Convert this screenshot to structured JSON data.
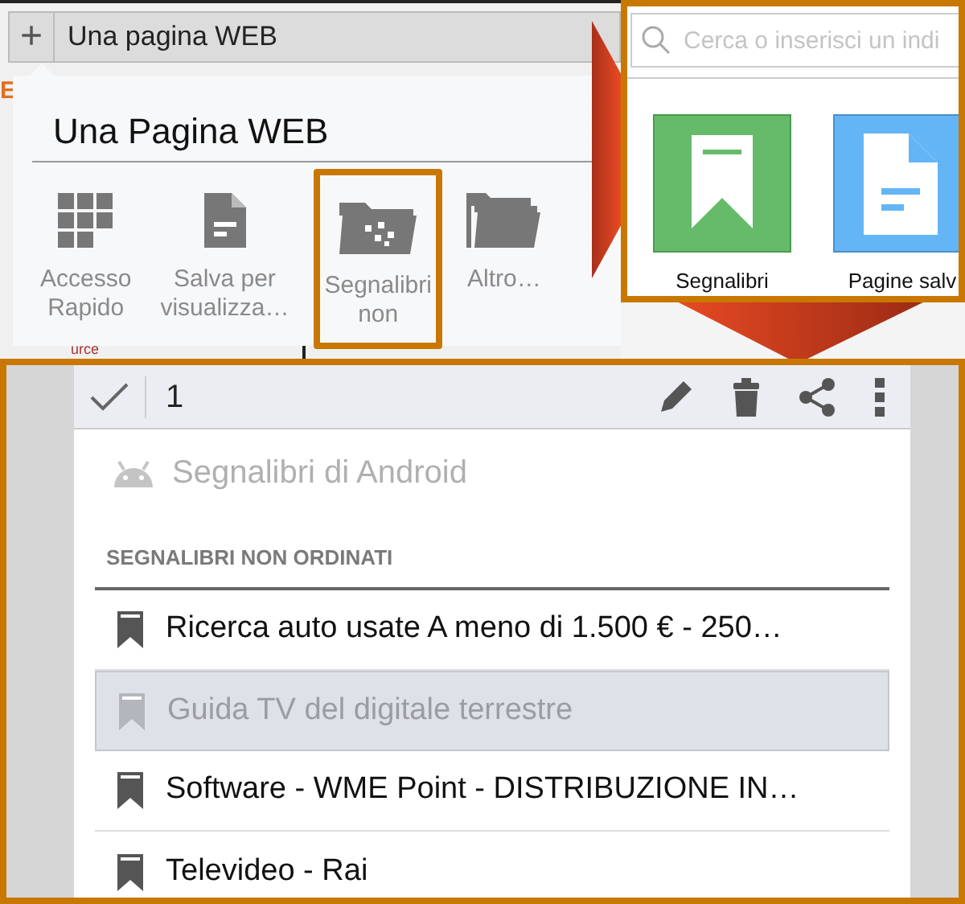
{
  "browser_tab": {
    "new_tab_button": "+",
    "title": "Una pagina WEB"
  },
  "page_fragments": [
    "E",
    "urce"
  ],
  "save_menu": {
    "title": "Una Pagina WEB",
    "options": [
      {
        "kind": "grid",
        "lines": [
          "Accesso",
          "Rapido"
        ],
        "highlighted": false
      },
      {
        "kind": "document",
        "lines": [
          "Salva per",
          "visualizza…"
        ],
        "highlighted": false
      },
      {
        "kind": "bookmark-folder",
        "lines": [
          "Segnalibri",
          "non"
        ],
        "highlighted": true
      },
      {
        "kind": "folders",
        "lines": [
          "Altro…"
        ],
        "highlighted": false
      }
    ]
  },
  "start_page": {
    "search": {
      "placeholder": "Cerca o inserisci un indi"
    },
    "tiles": [
      {
        "kind": "bookmark",
        "label": "Segnalibri"
      },
      {
        "kind": "document",
        "label": "Pagine salv"
      }
    ]
  },
  "bookmarks": {
    "toolbar": {
      "selected_count": "1"
    },
    "folder": "Segnalibri di Android",
    "section": "SEGNALIBRI NON ORDINATI",
    "items": [
      {
        "title": "Ricerca auto usate A meno di 1.500 € - 250…",
        "selected": false
      },
      {
        "title": "Guida TV del digitale terrestre",
        "selected": true
      },
      {
        "title": "Software - WME Point - DISTRIBUZIONE IN…",
        "selected": false
      },
      {
        "title": "Televideo - Rai",
        "selected": false
      }
    ]
  }
}
